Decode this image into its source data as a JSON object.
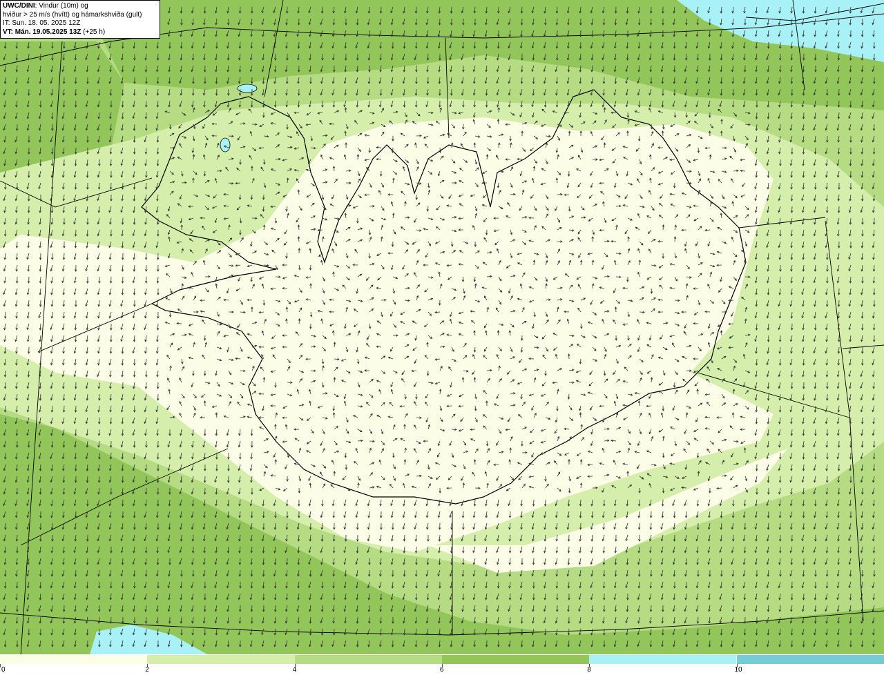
{
  "title": {
    "product": "UWC/DINI",
    "line1_rest": ": Vindur (10m) og",
    "line2": "hviður > 25 m/s (hvítt) og hámarkshviða (gult)",
    "init_time": "IT: Sun. 18. 05. 2025 12Z",
    "valid_prefix": "VT: Mán. 19.05.2025 13Z",
    "valid_suffix": " (+25 h)"
  },
  "legend": {
    "bins": [
      {
        "from": 0,
        "to": 2,
        "color": "#fbfde6"
      },
      {
        "from": 2,
        "to": 4,
        "color": "#d5eeac"
      },
      {
        "from": 4,
        "to": 6,
        "color": "#b5dc82"
      },
      {
        "from": 6,
        "to": 8,
        "color": "#93c65a"
      },
      {
        "from": 8,
        "to": 10,
        "color": "#a8f1f6"
      },
      {
        "from": 10,
        "to": 12,
        "color": "#75ccd6"
      }
    ],
    "tick_labels": [
      "0",
      "2",
      "4",
      "6",
      "8",
      "10"
    ]
  },
  "colors": {
    "ocean_strong": "#93c65a",
    "ocean_mid": "#b5dc82",
    "light": "#d5eeac",
    "calm": "#fbfde6",
    "sea_ice_cyan": "#a8f1f6",
    "coastline": "#000000",
    "arrow": "#333333"
  },
  "wind": {
    "prevailing": "north-westerly over the sea, variable over land",
    "icon": "wind-arrow-icon"
  }
}
